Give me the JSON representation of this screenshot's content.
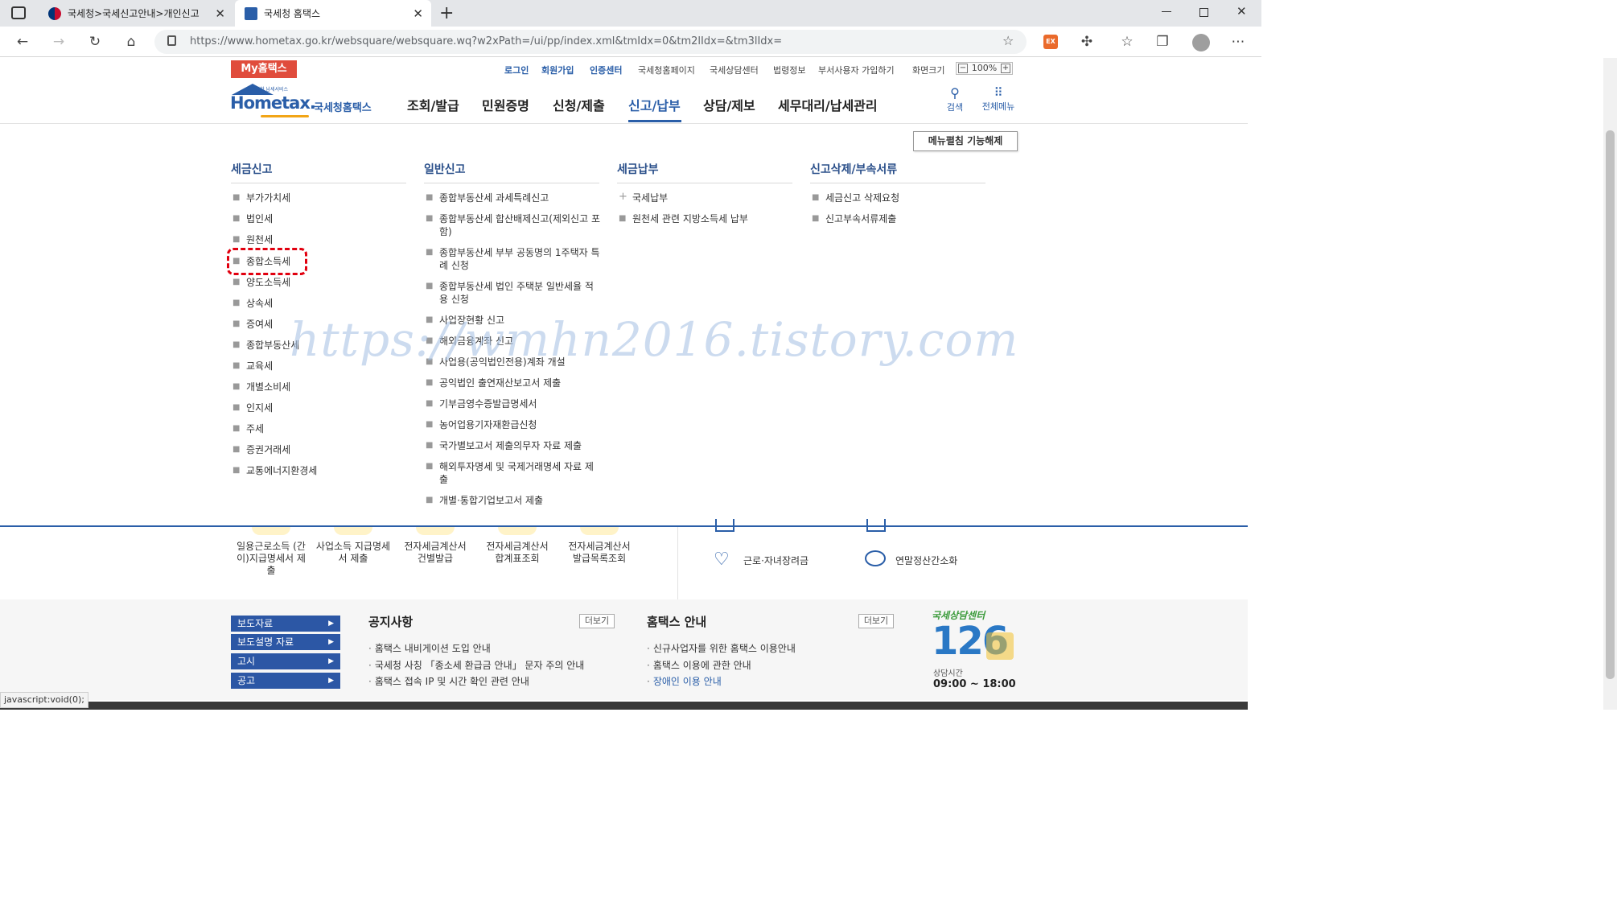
{
  "browser": {
    "tabs": [
      {
        "title": "국세청>국세신고안내>개인신고"
      },
      {
        "title": "국세청 홈택스"
      }
    ],
    "url": "https://www.hometax.go.kr/websquare/websquare.wq?w2xPath=/ui/pp/index.xml&tmIdx=0&tm2lIdx=&tm3lIdx=",
    "status": "javascript:void(0);",
    "new_tab": "+",
    "close_glyph": "✕",
    "ext_badge": "EX"
  },
  "header": {
    "my_hometax": "My홈택스",
    "util": [
      "로그인",
      "회원가입",
      "인증센터",
      "국세청홈페이지",
      "국세상담센터",
      "법령정보",
      "부서사용자 가입하기",
      "화면크기"
    ],
    "zoom": "100%",
    "logo_main": "Hometax.",
    "logo_small": "편리한 납세서비스",
    "logo_sub": "국세청홈택스",
    "gnb": [
      "조회/발급",
      "민원증명",
      "신청/제출",
      "신고/납부",
      "상담/제보",
      "세무대리/납세관리"
    ],
    "search": "검색",
    "all_menu": "전체메뉴",
    "menu_close": "메뉴펼침 기능해제"
  },
  "menu": {
    "col1": {
      "title": "세금신고",
      "items": [
        "부가가치세",
        "법인세",
        "원천세",
        "종합소득세",
        "양도소득세",
        "상속세",
        "증여세",
        "종합부동산세",
        "교육세",
        "개별소비세",
        "인지세",
        "주세",
        "증권거래세",
        "교통에너지환경세"
      ]
    },
    "col2": {
      "title": "일반신고",
      "items": [
        "종합부동산세 과세특례신고",
        "종합부동산세 합산배제신고(제외신고 포함)",
        "종합부동산세 부부 공동명의 1주택자 특례 신청",
        "종합부동산세 법인 주택분 일반세율 적용 신청",
        "사업장현황 신고",
        "해외금융계좌 신고",
        "사업용(공익법인전용)계좌 개설",
        "공익법인 출연재산보고서 제출",
        "기부금영수증발급명세서",
        "농어업용기자재환급신청",
        "국가별보고서 제출의무자 자료 제출",
        "해외투자명세 및 국제거래명세 자료 제출",
        "개별·통합기업보고서 제출"
      ]
    },
    "col3": {
      "title": "세금납부",
      "items": [
        "국세납부",
        "원천세 관련 지방소득세 납부"
      ]
    },
    "col4": {
      "title": "신고삭제/부속서류",
      "items": [
        "세금신고 삭제요청",
        "신고부속서류제출"
      ]
    }
  },
  "watermark": "https://wmhn2016.tistory.com",
  "quick": {
    "items": [
      "일용근로소득 (간이)지급명세서 제출",
      "사업소득 지급명세서 제출",
      "전자세금계산서 건별발급",
      "전자세금계산서 합계표조회",
      "전자세금계산서 발급목록조회"
    ],
    "right": [
      "근로·자녀장려금",
      "연말정산간소화"
    ]
  },
  "footer": {
    "nav": [
      "보도자료",
      "보도설명 자료",
      "고시",
      "공고"
    ],
    "notice_title": "공지사항",
    "notice_more": "더보기",
    "notices": [
      "홈택스 내비게이션 도입 안내",
      "국세청 사칭 「종소세 환급금 안내」 문자 주의 안내",
      "홈택스 접속 IP 및 시간 확인 관련 안내"
    ],
    "guide_title": "홈택스 안내",
    "guide_more": "더보기",
    "guides": [
      "신규사업자를 위한 홈택스 이용안내",
      "홈택스 이용에 관한 안내",
      "장애인 이용 안내"
    ],
    "center_title": "국세상담센터",
    "center_number": "126",
    "center_hours_label": "상담시간",
    "center_hours": "09:00 ~ 18:00"
  },
  "colors": {
    "brand_blue": "#2a5ea8",
    "my_red": "#e04c3c",
    "highlight_red": "#e1000f",
    "nav_blue": "#2c57a5"
  }
}
